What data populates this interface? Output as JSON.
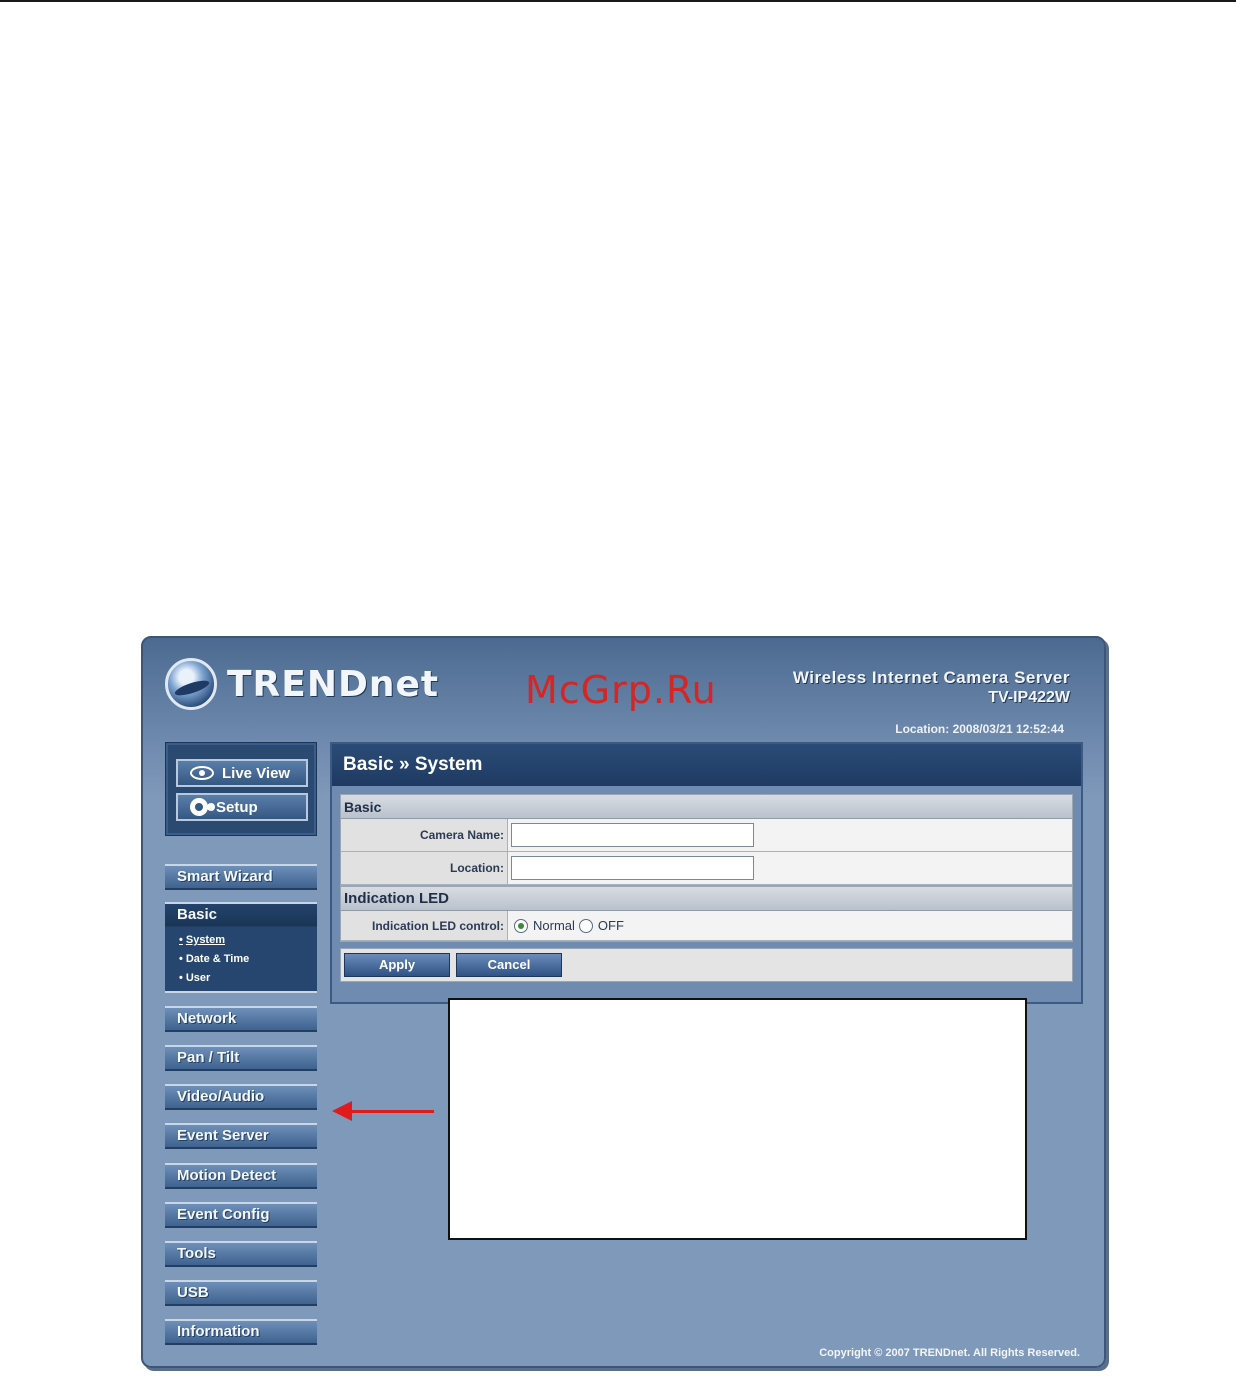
{
  "header": {
    "logo_text": "TRENDnet",
    "watermark": "McGrp.Ru",
    "product_name": "Wireless Internet Camera Server",
    "product_model": "TV-IP422W",
    "location_time": "Location: 2008/03/21 12:52:44"
  },
  "top_buttons": {
    "live_view": "Live View",
    "setup": "Setup"
  },
  "nav": {
    "smart_wizard": "Smart Wizard",
    "basic": "Basic",
    "sub": [
      "System",
      "Date & Time",
      "User"
    ],
    "network": "Network",
    "pan_tilt": "Pan / Tilt",
    "video_audio": "Video/Audio",
    "event_server": "Event Server",
    "motion_detect": "Motion Detect",
    "event_config": "Event Config",
    "tools": "Tools",
    "usb": "USB",
    "information": "Information"
  },
  "panel": {
    "title": "Basic » System",
    "basic_section": "Basic",
    "camera_name_label": "Camera Name:",
    "camera_name_value": "",
    "location_label": "Location:",
    "location_value": "",
    "led_section": "Indication LED",
    "led_label": "Indication LED control:",
    "led_options": [
      "Normal",
      "OFF"
    ],
    "led_selected": "Normal",
    "apply": "Apply",
    "cancel": "Cancel"
  },
  "footer": {
    "copyright": "Copyright © 2007 TRENDnet. All Rights Reserved."
  },
  "icons": {
    "live_view": "eye-icon",
    "setup": "gear-icon",
    "logo": "trendnet-logo-icon"
  },
  "colors": {
    "frame": "#7f99bb",
    "header_dark": "#1e3a62",
    "watermark": "#d62525",
    "arrow": "#e11b1b"
  }
}
